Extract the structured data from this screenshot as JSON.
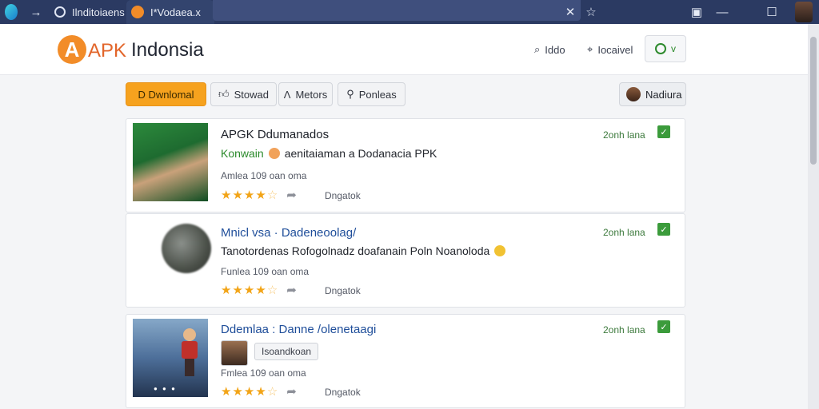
{
  "browser": {
    "tabs": [
      {
        "label": "Ilnditoiaens"
      },
      {
        "label": "I*Vodaea.x"
      }
    ]
  },
  "site": {
    "logo_letter": "A",
    "logo_apk": "APK",
    "logo_name": "Indonsia",
    "header_links": [
      {
        "label": "Iddo",
        "icon": "search-icon"
      },
      {
        "label": "Iocaivel",
        "icon": "tag-icon"
      }
    ],
    "status_button_label": "v"
  },
  "toolbar": {
    "download_label": "D Dwnlomal",
    "stowad_label": "Stowad",
    "metors_label": "Metors",
    "ponleas_label": "Ponleas",
    "user_label": "Nadiura"
  },
  "cards": [
    {
      "title": "APGK Ddumanados",
      "line2_green": "Konwain",
      "line2_text": "aenitaiaman a Dodanacia PPK",
      "meta": "Amlea 109 oan oma",
      "rating": 4,
      "tag": "Dngatok",
      "time": "2onh lana"
    },
    {
      "title": "Mnicl vsa · Dadeneoolag/",
      "line2_text": "Tanotordenas Rofogolnadz doafanain Poln Noanoloda",
      "meta": "Funlea 109 oan oma",
      "rating": 4,
      "tag": "Dngatok",
      "time": "2onh lana"
    },
    {
      "title": "Ddemlaa : Danne /olenetaagi",
      "chip_label": "Isoandkoan",
      "meta": "Fmlea 109 oan oma",
      "rating": 4,
      "tag": "Dngatok",
      "time": "2onh lana"
    }
  ],
  "colors": {
    "chrome": "#2b3a62",
    "accent_orange": "#f28c28",
    "primary_button": "#f6a21e",
    "check_green": "#3b9b3b",
    "title_blue": "#1f4e9a",
    "star": "#f2a417"
  }
}
